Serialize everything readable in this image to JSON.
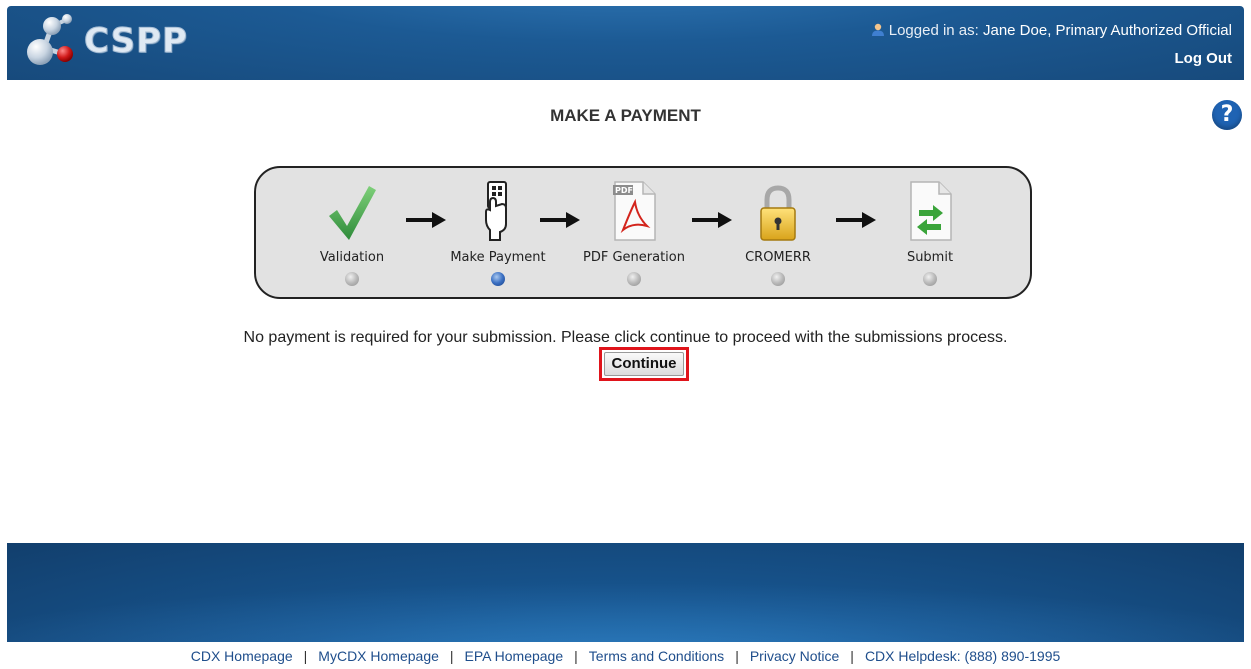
{
  "header": {
    "app_name": "CSPP",
    "login_prefix": "Logged in as:",
    "user": "Jane Doe, Primary Authorized Official",
    "logout_label": "Log Out"
  },
  "page": {
    "title": "MAKE A PAYMENT",
    "help_icon": "?"
  },
  "steps": [
    {
      "label": "Validation",
      "icon": "checkmark-icon",
      "active": false
    },
    {
      "label": "Make Payment",
      "icon": "payment-card-icon",
      "active": true
    },
    {
      "label": "PDF Generation",
      "icon": "pdf-file-icon",
      "active": false
    },
    {
      "label": "CROMERR",
      "icon": "padlock-icon",
      "active": false
    },
    {
      "label": "Submit",
      "icon": "submit-document-icon",
      "active": false
    }
  ],
  "message": "No payment is required for your submission. Please click continue to proceed with the submissions process.",
  "continue_label": "Continue",
  "footer": {
    "links": [
      "CDX Homepage",
      "MyCDX Homepage",
      "EPA Homepage",
      "Terms and Conditions",
      "Privacy Notice",
      "CDX Helpdesk: (888) 890-1995"
    ]
  },
  "colors": {
    "header_blue": "#1c5a94",
    "accent_red": "#e0141b",
    "active_dot": "#3a6fc2",
    "link_blue": "#1f4e8c"
  }
}
